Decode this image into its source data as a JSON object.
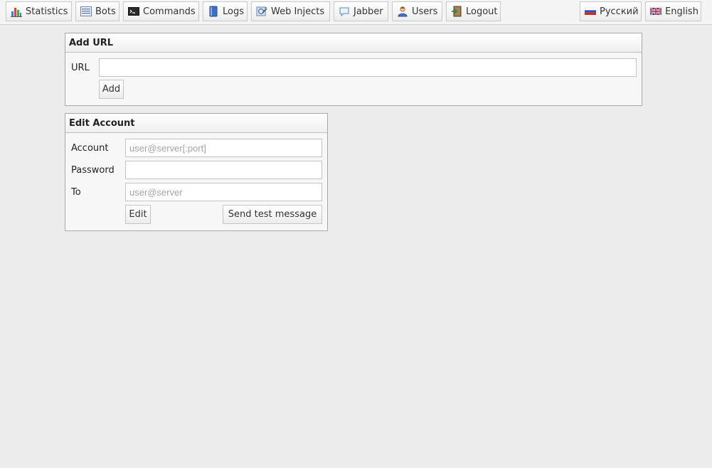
{
  "nav": {
    "items": [
      {
        "label": "Statistics",
        "icon": "bar-chart-icon"
      },
      {
        "label": "Bots",
        "icon": "list-icon"
      },
      {
        "label": "Commands",
        "icon": "terminal-icon"
      },
      {
        "label": "Logs",
        "icon": "book-icon"
      },
      {
        "label": "Web Injects",
        "icon": "web-inject-icon"
      },
      {
        "label": "Jabber",
        "icon": "chat-bubble-icon"
      },
      {
        "label": "Users",
        "icon": "user-icon"
      },
      {
        "label": "Logout",
        "icon": "logout-icon"
      }
    ],
    "languages": [
      {
        "label": "Русский",
        "icon": "russia-flag-icon"
      },
      {
        "label": "English",
        "icon": "uk-flag-icon"
      }
    ]
  },
  "add_url": {
    "title": "Add URL",
    "url_label": "URL",
    "url_value": "",
    "add_button": "Add"
  },
  "edit_account": {
    "title": "Edit Account",
    "account_label": "Account",
    "account_placeholder": "user@server[:port]",
    "password_label": "Password",
    "to_label": "To",
    "to_placeholder": "user@server",
    "edit_button": "Edit",
    "send_button": "Send test message"
  }
}
